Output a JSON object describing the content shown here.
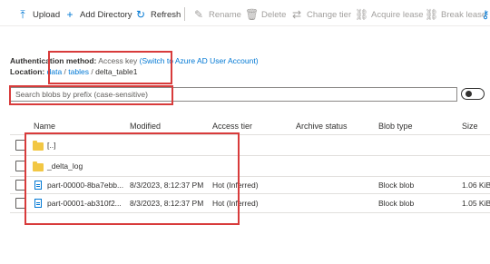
{
  "toolbar": {
    "upload": "Upload",
    "add_directory": "Add Directory",
    "refresh": "Refresh",
    "rename": "Rename",
    "delete": "Delete",
    "change_tier": "Change tier",
    "acquire_lease": "Acquire lease",
    "break_lease": "Break lease"
  },
  "auth": {
    "label": "Authentication method:",
    "value": "Access key",
    "switch_link": "(Switch to Azure AD User Account)"
  },
  "location": {
    "label": "Location:",
    "crumbs": [
      "data",
      "tables",
      "delta_table1"
    ],
    "separator": "/"
  },
  "search": {
    "placeholder": "Search blobs by prefix (case-sensitive)"
  },
  "table": {
    "columns": [
      "Name",
      "Modified",
      "Access tier",
      "Archive status",
      "Blob type",
      "Size"
    ],
    "rows": [
      {
        "name": "[..]",
        "modified": "",
        "access_tier": "",
        "archive_status": "",
        "blob_type": "",
        "size": "",
        "kind": "folder"
      },
      {
        "name": "_delta_log",
        "modified": "",
        "access_tier": "",
        "archive_status": "",
        "blob_type": "",
        "size": "",
        "kind": "folder"
      },
      {
        "name": "part-00000-8ba7ebb...",
        "modified": "8/3/2023, 8:12:37 PM",
        "access_tier": "Hot (Inferred)",
        "archive_status": "",
        "blob_type": "Block blob",
        "size": "1.06 KiB",
        "kind": "file"
      },
      {
        "name": "part-00001-ab310f2...",
        "modified": "8/3/2023, 8:12:37 PM",
        "access_tier": "Hot (Inferred)",
        "archive_status": "",
        "blob_type": "Block blob",
        "size": "1.05 KiB",
        "kind": "file"
      }
    ]
  },
  "colors": {
    "accent": "#0078d4",
    "highlight_box": "#d83b3b",
    "folder": "#f2c744"
  }
}
